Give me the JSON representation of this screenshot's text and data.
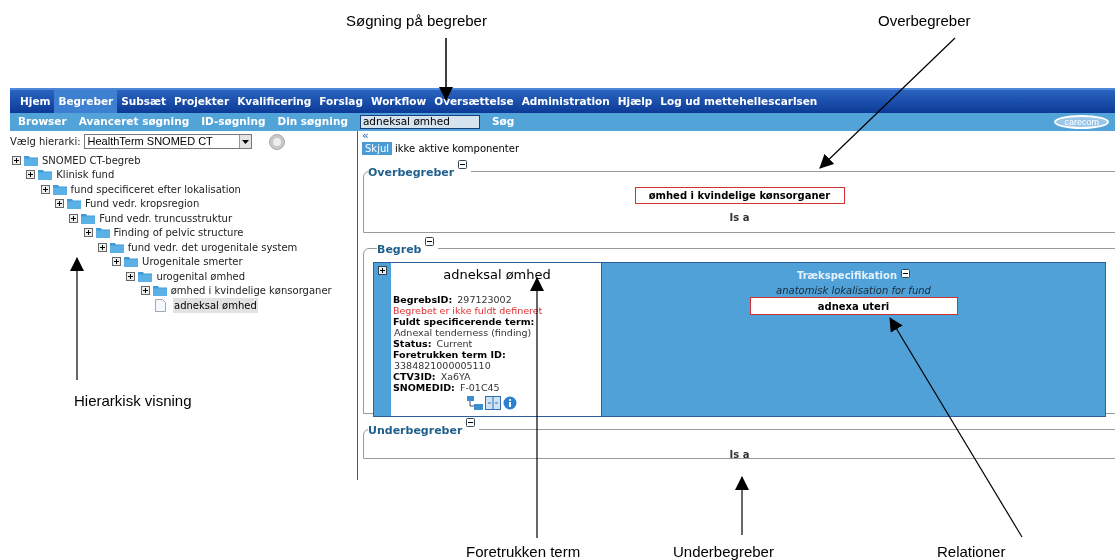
{
  "annotations": [
    {
      "text": "Søgning på begreber"
    },
    {
      "text": "Overbegreber"
    },
    {
      "text": "Hierarkisk visning"
    },
    {
      "text": "Foretrukken term"
    },
    {
      "text": "Underbegreber"
    },
    {
      "text": "Relationer"
    }
  ],
  "nav": {
    "items": [
      {
        "label": "Hjem",
        "selected": false
      },
      {
        "label": "Begreber",
        "selected": true
      },
      {
        "label": "Subsæt",
        "selected": false
      },
      {
        "label": "Projekter",
        "selected": false
      },
      {
        "label": "Kvalificering",
        "selected": false
      },
      {
        "label": "Forslag",
        "selected": false
      },
      {
        "label": "Workflow",
        "selected": false
      },
      {
        "label": "Oversættelse",
        "selected": false
      },
      {
        "label": "Administration",
        "selected": false
      },
      {
        "label": "Hjælp",
        "selected": false
      },
      {
        "label": "Log ud mettehellescarlsen",
        "selected": false
      }
    ]
  },
  "subnav": {
    "links": [
      "Browser",
      "Avanceret søgning",
      "ID-søgning",
      "Din søgning"
    ],
    "search": {
      "value": "adneksal ømhed"
    },
    "search_button": "Søg",
    "logo": "carecom"
  },
  "hierarchy": {
    "label": "Vælg hierarki:",
    "value": "HealthTerm SNOMED CT"
  },
  "tree": [
    {
      "label": "SNOMED CT-begreb",
      "kind": "folder",
      "selected": false,
      "children": [
        {
          "label": "Klinisk fund",
          "kind": "folder",
          "selected": false,
          "children": [
            {
              "label": "fund specificeret efter lokalisation",
              "kind": "folder",
              "selected": false,
              "children": [
                {
                  "label": "Fund vedr. kropsregion",
                  "kind": "folder",
                  "selected": false,
                  "children": [
                    {
                      "label": "Fund vedr. truncusstruktur",
                      "kind": "folder",
                      "selected": false,
                      "children": [
                        {
                          "label": "Finding of pelvic structure",
                          "kind": "folder",
                          "selected": false,
                          "children": [
                            {
                              "label": "fund vedr. det urogenitale system",
                              "kind": "folder",
                              "selected": false,
                              "children": [
                                {
                                  "label": "Urogenitale smerter",
                                  "kind": "folder",
                                  "selected": false,
                                  "children": [
                                    {
                                      "label": "urogenital ømhed",
                                      "kind": "folder",
                                      "selected": false,
                                      "children": [
                                        {
                                          "label": "ømhed i kvindelige kønsorganer",
                                          "kind": "folder",
                                          "selected": false,
                                          "children": [
                                            {
                                              "label": "adneksal ømhed",
                                              "kind": "leaf",
                                              "selected": true
                                            }
                                          ]
                                        }
                                      ]
                                    }
                                  ]
                                }
                              ]
                            }
                          ]
                        }
                      ]
                    }
                  ]
                }
              ]
            }
          ]
        }
      ]
    }
  ],
  "collapse": "«",
  "hide_button": "Skjul",
  "hide_label": "ikke aktive komponenter",
  "overbegreber": {
    "title": "Overbegreber",
    "concepts": [
      "ømhed i kvindelige kønsorganer"
    ],
    "relation": "Is a"
  },
  "begreb": {
    "title": "Begreb",
    "name": "adneksal ømhed",
    "details": [
      {
        "kind": "inline",
        "label": "BegrebsID:",
        "value": "297123002"
      },
      {
        "kind": "warning",
        "value": "Begrebet er ikke fuldt defineret"
      },
      {
        "kind": "block",
        "label": "Fuldt specificerende term:",
        "value": "Adnexal tenderness (finding)"
      },
      {
        "kind": "inline",
        "label": "Status:",
        "value": "Current"
      },
      {
        "kind": "block",
        "label": "Foretrukken term ID:",
        "value": "3384821000005110"
      },
      {
        "kind": "inline",
        "label": "CTV3ID:",
        "value": "Xa6YA"
      },
      {
        "kind": "inline",
        "label": "SNOMEDID:",
        "value": "F-01C45"
      }
    ],
    "attributes": {
      "title": "Trækspecifikation",
      "relations": [
        {
          "type": "anatomisk lokalisation for fund",
          "target": "adnexa uteri"
        }
      ]
    }
  },
  "underbegreber": {
    "title": "Underbegreber",
    "relation": "Is a"
  }
}
